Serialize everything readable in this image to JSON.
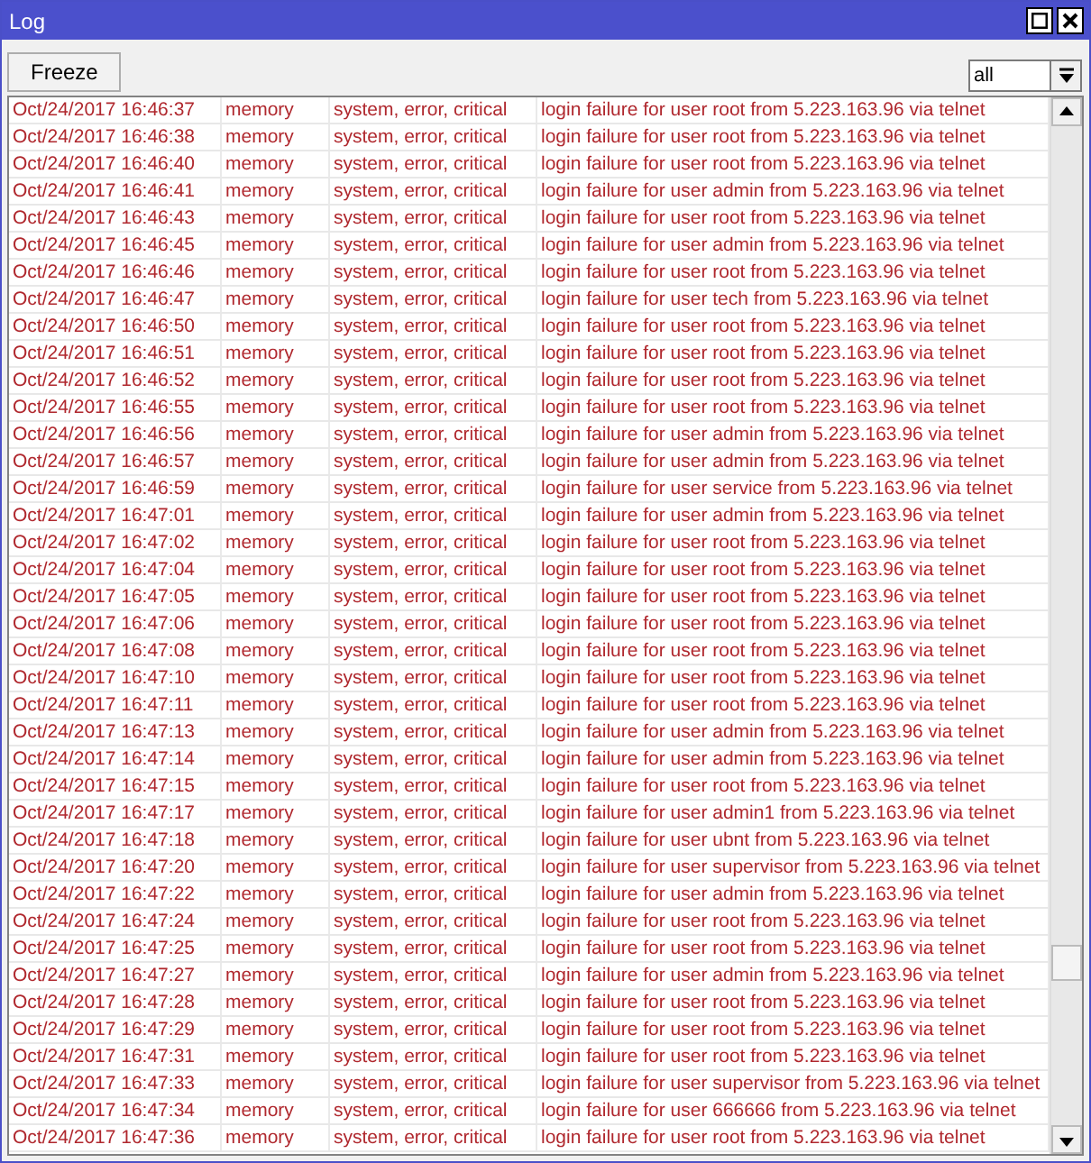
{
  "window": {
    "title": "Log"
  },
  "toolbar": {
    "freeze_button": "Freeze",
    "filter": {
      "value": "all"
    }
  },
  "log": {
    "rows": [
      {
        "time": "Oct/24/2017 16:46:37",
        "buffer": "memory",
        "topics": "system, error, critical",
        "message": "login failure for user root from 5.223.163.96 via telnet"
      },
      {
        "time": "Oct/24/2017 16:46:38",
        "buffer": "memory",
        "topics": "system, error, critical",
        "message": "login failure for user root from 5.223.163.96 via telnet"
      },
      {
        "time": "Oct/24/2017 16:46:40",
        "buffer": "memory",
        "topics": "system, error, critical",
        "message": "login failure for user root from 5.223.163.96 via telnet"
      },
      {
        "time": "Oct/24/2017 16:46:41",
        "buffer": "memory",
        "topics": "system, error, critical",
        "message": "login failure for user admin from 5.223.163.96 via telnet"
      },
      {
        "time": "Oct/24/2017 16:46:43",
        "buffer": "memory",
        "topics": "system, error, critical",
        "message": "login failure for user root from 5.223.163.96 via telnet"
      },
      {
        "time": "Oct/24/2017 16:46:45",
        "buffer": "memory",
        "topics": "system, error, critical",
        "message": "login failure for user admin from 5.223.163.96 via telnet"
      },
      {
        "time": "Oct/24/2017 16:46:46",
        "buffer": "memory",
        "topics": "system, error, critical",
        "message": "login failure for user root from 5.223.163.96 via telnet"
      },
      {
        "time": "Oct/24/2017 16:46:47",
        "buffer": "memory",
        "topics": "system, error, critical",
        "message": "login failure for user tech from 5.223.163.96 via telnet"
      },
      {
        "time": "Oct/24/2017 16:46:50",
        "buffer": "memory",
        "topics": "system, error, critical",
        "message": "login failure for user root from 5.223.163.96 via telnet"
      },
      {
        "time": "Oct/24/2017 16:46:51",
        "buffer": "memory",
        "topics": "system, error, critical",
        "message": "login failure for user root from 5.223.163.96 via telnet"
      },
      {
        "time": "Oct/24/2017 16:46:52",
        "buffer": "memory",
        "topics": "system, error, critical",
        "message": "login failure for user root from 5.223.163.96 via telnet"
      },
      {
        "time": "Oct/24/2017 16:46:55",
        "buffer": "memory",
        "topics": "system, error, critical",
        "message": "login failure for user root from 5.223.163.96 via telnet"
      },
      {
        "time": "Oct/24/2017 16:46:56",
        "buffer": "memory",
        "topics": "system, error, critical",
        "message": "login failure for user admin from 5.223.163.96 via telnet"
      },
      {
        "time": "Oct/24/2017 16:46:57",
        "buffer": "memory",
        "topics": "system, error, critical",
        "message": "login failure for user admin from 5.223.163.96 via telnet"
      },
      {
        "time": "Oct/24/2017 16:46:59",
        "buffer": "memory",
        "topics": "system, error, critical",
        "message": "login failure for user service from 5.223.163.96 via telnet"
      },
      {
        "time": "Oct/24/2017 16:47:01",
        "buffer": "memory",
        "topics": "system, error, critical",
        "message": "login failure for user admin from 5.223.163.96 via telnet"
      },
      {
        "time": "Oct/24/2017 16:47:02",
        "buffer": "memory",
        "topics": "system, error, critical",
        "message": "login failure for user root from 5.223.163.96 via telnet"
      },
      {
        "time": "Oct/24/2017 16:47:04",
        "buffer": "memory",
        "topics": "system, error, critical",
        "message": "login failure for user root from 5.223.163.96 via telnet"
      },
      {
        "time": "Oct/24/2017 16:47:05",
        "buffer": "memory",
        "topics": "system, error, critical",
        "message": "login failure for user root from 5.223.163.96 via telnet"
      },
      {
        "time": "Oct/24/2017 16:47:06",
        "buffer": "memory",
        "topics": "system, error, critical",
        "message": "login failure for user root from 5.223.163.96 via telnet"
      },
      {
        "time": "Oct/24/2017 16:47:08",
        "buffer": "memory",
        "topics": "system, error, critical",
        "message": "login failure for user root from 5.223.163.96 via telnet"
      },
      {
        "time": "Oct/24/2017 16:47:10",
        "buffer": "memory",
        "topics": "system, error, critical",
        "message": "login failure for user root from 5.223.163.96 via telnet"
      },
      {
        "time": "Oct/24/2017 16:47:11",
        "buffer": "memory",
        "topics": "system, error, critical",
        "message": "login failure for user root from 5.223.163.96 via telnet"
      },
      {
        "time": "Oct/24/2017 16:47:13",
        "buffer": "memory",
        "topics": "system, error, critical",
        "message": "login failure for user admin from 5.223.163.96 via telnet"
      },
      {
        "time": "Oct/24/2017 16:47:14",
        "buffer": "memory",
        "topics": "system, error, critical",
        "message": "login failure for user admin from 5.223.163.96 via telnet"
      },
      {
        "time": "Oct/24/2017 16:47:15",
        "buffer": "memory",
        "topics": "system, error, critical",
        "message": "login failure for user root from 5.223.163.96 via telnet"
      },
      {
        "time": "Oct/24/2017 16:47:17",
        "buffer": "memory",
        "topics": "system, error, critical",
        "message": "login failure for user admin1 from 5.223.163.96 via telnet"
      },
      {
        "time": "Oct/24/2017 16:47:18",
        "buffer": "memory",
        "topics": "system, error, critical",
        "message": "login failure for user ubnt from 5.223.163.96 via telnet"
      },
      {
        "time": "Oct/24/2017 16:47:20",
        "buffer": "memory",
        "topics": "system, error, critical",
        "message": "login failure for user supervisor from 5.223.163.96 via telnet"
      },
      {
        "time": "Oct/24/2017 16:47:22",
        "buffer": "memory",
        "topics": "system, error, critical",
        "message": "login failure for user admin from 5.223.163.96 via telnet"
      },
      {
        "time": "Oct/24/2017 16:47:24",
        "buffer": "memory",
        "topics": "system, error, critical",
        "message": "login failure for user root from 5.223.163.96 via telnet"
      },
      {
        "time": "Oct/24/2017 16:47:25",
        "buffer": "memory",
        "topics": "system, error, critical",
        "message": "login failure for user root from 5.223.163.96 via telnet"
      },
      {
        "time": "Oct/24/2017 16:47:27",
        "buffer": "memory",
        "topics": "system, error, critical",
        "message": "login failure for user admin from 5.223.163.96 via telnet"
      },
      {
        "time": "Oct/24/2017 16:47:28",
        "buffer": "memory",
        "topics": "system, error, critical",
        "message": "login failure for user root from 5.223.163.96 via telnet"
      },
      {
        "time": "Oct/24/2017 16:47:29",
        "buffer": "memory",
        "topics": "system, error, critical",
        "message": "login failure for user root from 5.223.163.96 via telnet"
      },
      {
        "time": "Oct/24/2017 16:47:31",
        "buffer": "memory",
        "topics": "system, error, critical",
        "message": "login failure for user root from 5.223.163.96 via telnet"
      },
      {
        "time": "Oct/24/2017 16:47:33",
        "buffer": "memory",
        "topics": "system, error, critical",
        "message": "login failure for user supervisor from 5.223.163.96 via telnet"
      },
      {
        "time": "Oct/24/2017 16:47:34",
        "buffer": "memory",
        "topics": "system, error, critical",
        "message": "login failure for user 666666 from 5.223.163.96 via telnet"
      },
      {
        "time": "Oct/24/2017 16:47:36",
        "buffer": "memory",
        "topics": "system, error, critical",
        "message": "login failure for user root from 5.223.163.96 via telnet"
      }
    ]
  }
}
